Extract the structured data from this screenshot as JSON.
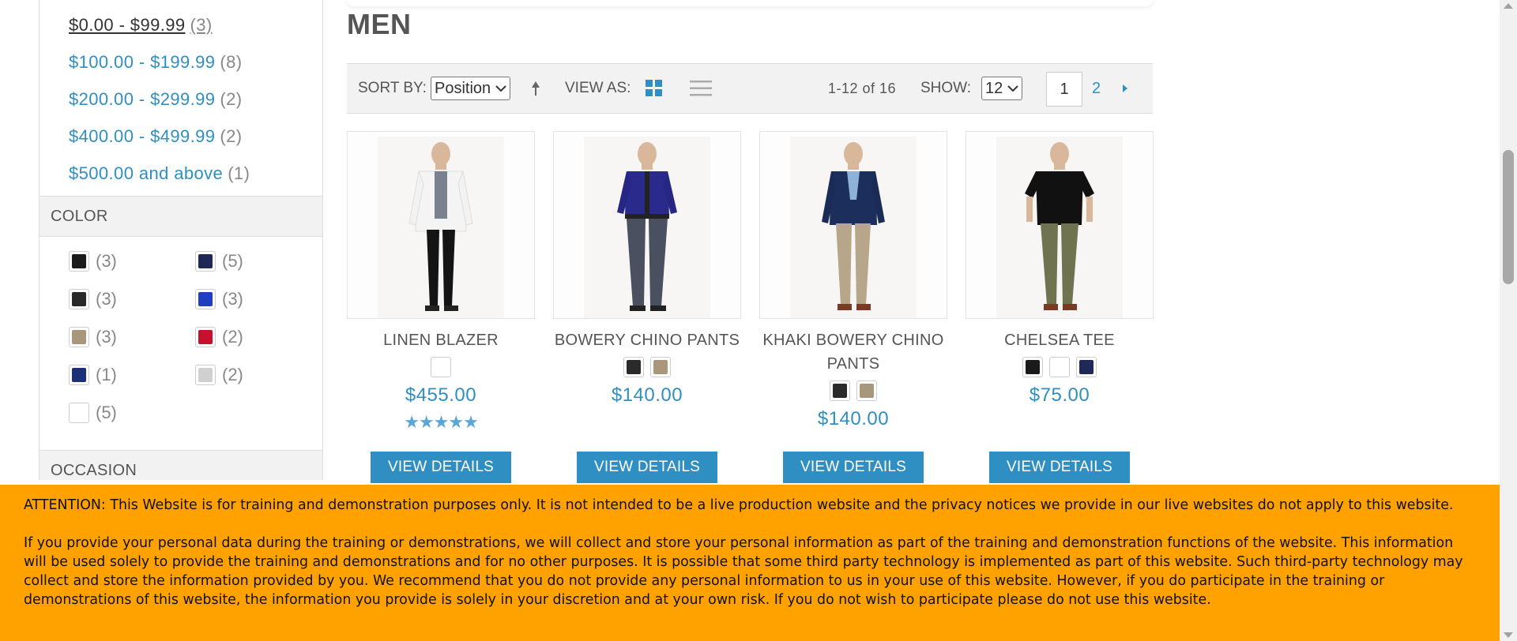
{
  "sidebar": {
    "price_ranges": [
      {
        "label": "$0.00 - $99.99",
        "count": "(3)"
      },
      {
        "label": "$100.00 - $199.99",
        "count": "(8)"
      },
      {
        "label": "$200.00 - $299.99",
        "count": "(2)"
      },
      {
        "label": "$400.00 - $499.99",
        "count": "(2)"
      },
      {
        "label": "$500.00 and above",
        "count": "(1)"
      }
    ],
    "color_title": "COLOR",
    "colors": [
      {
        "hex": "#1a1a1a",
        "count": "(3)"
      },
      {
        "hex": "#1e2a55",
        "count": "(5)"
      },
      {
        "hex": "#2a2a2a",
        "count": "(3)"
      },
      {
        "hex": "#1f3ec2",
        "count": "(3)"
      },
      {
        "hex": "#a8977a",
        "count": "(3)"
      },
      {
        "hex": "#c8102e",
        "count": "(2)"
      },
      {
        "hex": "#1c2f7a",
        "count": "(1)"
      },
      {
        "hex": "#d0d0d0",
        "count": "(2)"
      },
      {
        "hex": "#ffffff",
        "count": "(5)"
      }
    ],
    "occasion_title": "OCCASION"
  },
  "main": {
    "title": "MEN",
    "toolbar": {
      "sort_label": "SORT BY:",
      "sort_value": "Position",
      "view_label": "VIEW AS:",
      "count_text": "1-12 of 16",
      "show_label": "SHOW:",
      "show_value": "12",
      "current_page": "1",
      "next_page": "2"
    },
    "products": [
      {
        "name": "LINEN BLAZER",
        "price": "$455.00",
        "colors": [
          "#ffffff"
        ],
        "rating": "★★★★★",
        "button": "VIEW DETAILS"
      },
      {
        "name": "BOWERY CHINO PANTS",
        "price": "$140.00",
        "colors": [
          "#2a2a2a",
          "#a8977a"
        ],
        "rating": "",
        "button": "VIEW DETAILS"
      },
      {
        "name": "KHAKI BOWERY CHINO PANTS",
        "price": "$140.00",
        "colors": [
          "#2a2a2a",
          "#a8977a"
        ],
        "rating": "",
        "button": "VIEW DETAILS"
      },
      {
        "name": "CHELSEA TEE",
        "price": "$75.00",
        "colors": [
          "#1a1a1a",
          "#ffffff",
          "#1e2a55"
        ],
        "rating": "",
        "button": "VIEW DETAILS"
      }
    ]
  },
  "notice": {
    "paragraph1": "ATTENTION: This Website is for training and demonstration purposes only. It is not intended to be a live production website and the privacy notices we provide in our live websites do not apply to this website.",
    "paragraph2": "If you provide your personal data during the training or demonstrations, we will collect and store your personal information as part of the training and demonstration functions of the website. This information will be used solely to provide the training and demonstrations and for no other purposes. It is possible that some third party technology is implemented as part of this website. Such third-party technology may collect and store the information provided by you. We recommend that you do not provide any personal information to us in your use of this website. However, if you do participate in the training or demonstrations of this website, the information you provide is solely in your discretion and at your own risk. If you do not wish to participate please do not use this website."
  },
  "colors": {
    "accent": "#2f8fc3",
    "notice_bg": "#ffa200"
  }
}
